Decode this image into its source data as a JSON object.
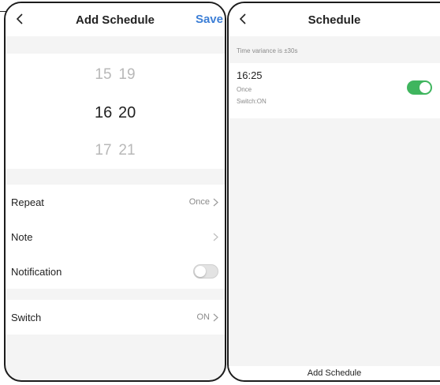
{
  "left": {
    "title": "Add Schedule",
    "save_label": "Save",
    "picker": {
      "above": {
        "hour": "15",
        "minute": "19"
      },
      "selected": {
        "hour": "16",
        "minute": "20"
      },
      "below": {
        "hour": "17",
        "minute": "21"
      }
    },
    "repeat": {
      "label": "Repeat",
      "value": "Once"
    },
    "note": {
      "label": "Note",
      "value": ""
    },
    "notification": {
      "label": "Notification",
      "enabled": false
    },
    "switch": {
      "label": "Switch",
      "value": "ON"
    }
  },
  "right": {
    "title": "Schedule",
    "hint": "Time variance is ±30s",
    "schedule": {
      "time": "16:25",
      "repeat": "Once",
      "switch": "Switch:ON",
      "enabled": true
    },
    "add_label": "Add Schedule"
  },
  "colors": {
    "accent": "#3d7fd6",
    "toggle_on": "#3fb55e",
    "background": "#f4f4f4"
  },
  "icons": [
    "back-arrow-icon",
    "chevron-right-icon"
  ]
}
